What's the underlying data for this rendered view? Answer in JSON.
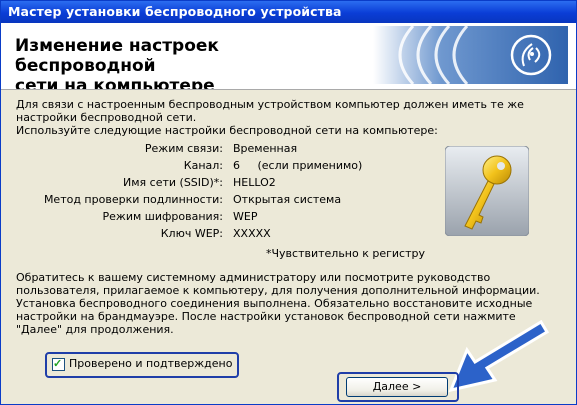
{
  "window": {
    "title": "Мастер установки беспроводного устройства"
  },
  "header": {
    "title_line1": "Изменение настроек беспроводной",
    "title_line2": "сети на компьютере"
  },
  "intro": {
    "line1": "Для связи с настроенным беспроводным устройством компьютер должен иметь те же",
    "line2": "настройки беспроводной сети.",
    "line3": "Используйте следующие настройки беспроводной сети на компьютере:"
  },
  "settings": [
    {
      "label": "Режим связи:",
      "value": "Временная"
    },
    {
      "label": "Канал:",
      "value": "6     (если применимо)"
    },
    {
      "label": "Имя сети (SSID)*:",
      "value": "HELLO2"
    },
    {
      "label": "Метод проверки подлинности:",
      "value": "Открытая система"
    },
    {
      "label": "Режим шифрования:",
      "value": "WEP"
    },
    {
      "label": "Ключ WEP:",
      "value": "XXXXX"
    }
  ],
  "case_note": "*Чувствительно к регистру",
  "advice": {
    "line1": "Обратитесь к вашему системному администратору или посмотрите руководство",
    "line2": "пользователя, прилагаемое к компьютеру, для получения дополнительной информации.",
    "line3": "Установка беспроводного соединения выполнена. Обязательно восстановите исходные",
    "line4": "настройки на брандмауэре. После настройки установок беспроводной сети нажмите",
    "line5": "\"Далее\" для продолжения."
  },
  "checkbox": {
    "label": "Проверено и подтверждено",
    "checked": true
  },
  "buttons": {
    "next": "Далее >"
  },
  "icons": {
    "banner": "wireless-signal-icon",
    "key": "key-icon",
    "pointer": "arrow-pointer-icon"
  },
  "colors": {
    "titlebar": "#0a3dd6",
    "highlight": "#1f3ea8",
    "banner": "#3a6fb8"
  }
}
